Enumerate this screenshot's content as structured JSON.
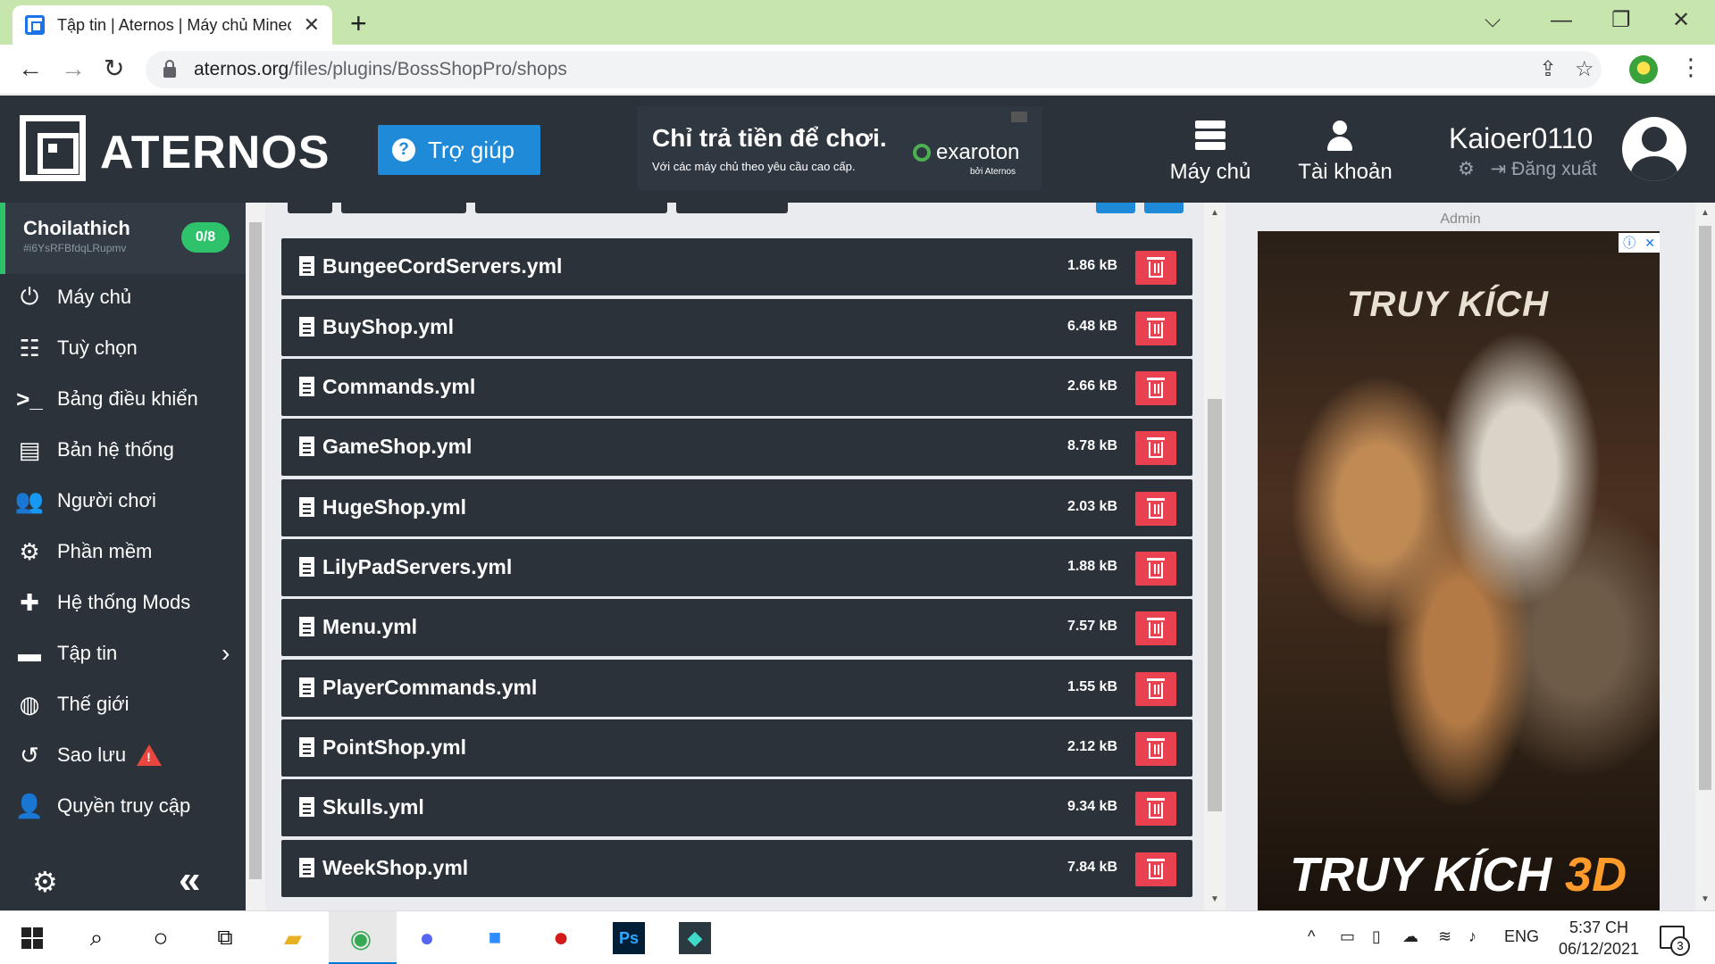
{
  "browser": {
    "tab_title": "Tập tin | Aternos | Máy chủ Minecraft",
    "tab_close": "✕",
    "new_tab": "+",
    "url_domain": "aternos.org",
    "url_path": "/files/plugins/BossShopPro/shops"
  },
  "header": {
    "logo": "ATERNOS",
    "help_label": "Trợ giúp",
    "ad": {
      "title": "Chỉ trả tiền để chơi.",
      "subtitle": "Với các máy chủ theo yêu cầu cao cấp.",
      "brand": "exaroton",
      "brand_sub": "bởi Aternos"
    },
    "nav_server": "Máy chủ",
    "nav_account": "Tài khoản",
    "username": "Kaioer0110",
    "logout": "Đăng xuất"
  },
  "sidebar": {
    "server_name": "Choilathich",
    "server_id": "#i6YsRFBfdqLRupmv",
    "slots": "0/8",
    "items": [
      {
        "label": "Máy chủ",
        "icon": "power-icon"
      },
      {
        "label": "Tuỳ chọn",
        "icon": "sliders-icon"
      },
      {
        "label": "Bảng điều khiển",
        "icon": "terminal-icon"
      },
      {
        "label": "Bản hệ thống",
        "icon": "file-icon"
      },
      {
        "label": "Người chơi",
        "icon": "users-icon"
      },
      {
        "label": "Phần mềm",
        "icon": "cogs-icon"
      },
      {
        "label": "Hệ thống Mods",
        "icon": "puzzle-icon"
      },
      {
        "label": "Tập tin",
        "icon": "folder-icon"
      },
      {
        "label": "Thế giới",
        "icon": "globe-icon"
      },
      {
        "label": "Sao lưu",
        "icon": "history-icon"
      },
      {
        "label": "Quyền truy cập",
        "icon": "user-lock-icon"
      }
    ]
  },
  "files": [
    {
      "name": "BungeeCordServers.yml",
      "size": "1.86 kB"
    },
    {
      "name": "BuyShop.yml",
      "size": "6.48 kB"
    },
    {
      "name": "Commands.yml",
      "size": "2.66 kB"
    },
    {
      "name": "GameShop.yml",
      "size": "8.78 kB"
    },
    {
      "name": "HugeShop.yml",
      "size": "2.03 kB"
    },
    {
      "name": "LilyPadServers.yml",
      "size": "1.88 kB"
    },
    {
      "name": "Menu.yml",
      "size": "7.57 kB"
    },
    {
      "name": "PlayerCommands.yml",
      "size": "1.55 kB"
    },
    {
      "name": "PointShop.yml",
      "size": "2.12 kB"
    },
    {
      "name": "Skulls.yml",
      "size": "9.34 kB"
    },
    {
      "name": "WeekShop.yml",
      "size": "7.84 kB"
    }
  ],
  "right_ad": {
    "label": "Admin",
    "logo": "TRUY KÍCH",
    "bottom_text": "TRUY KÍCH",
    "bottom_accent": "3D"
  },
  "taskbar": {
    "lang": "ENG",
    "time": "5:37 CH",
    "date": "06/12/2021",
    "notif_count": "3"
  },
  "colors": {
    "accent_green": "#2ec26a",
    "accent_blue": "#1f8ad8",
    "danger_red": "#e9414f",
    "panel_dark": "#2b323a"
  }
}
